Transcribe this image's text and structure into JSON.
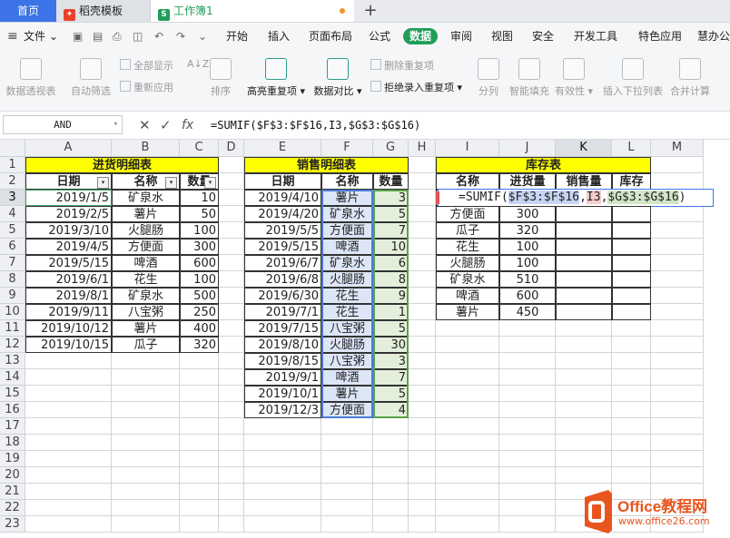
{
  "tabs": [
    {
      "label": "首页"
    },
    {
      "label": "稻壳模板"
    },
    {
      "label": "工作簿1"
    }
  ],
  "menu": {
    "file": "文件",
    "items": [
      "开始",
      "插入",
      "页面布局",
      "公式",
      "数据",
      "审阅",
      "视图",
      "安全",
      "开发工具",
      "特色应用",
      "慧办公"
    ]
  },
  "ribbon": {
    "pivot": "数据透视表",
    "autofilter": "自动筛选",
    "show_all": "全部显示",
    "reapply": "重新应用",
    "sort_az": "A↓Z",
    "sort": "排序",
    "highlight_dup": "高亮重复项",
    "data_compare": "数据对比",
    "del_dup": "删除重复项",
    "reject_dup": "拒绝录入重复项",
    "split": "分列",
    "smart_fill": "智能填充",
    "validity": "有效性",
    "insert_dropdown": "插入下拉列表",
    "merge_calc": "合并计算"
  },
  "formula_bar": {
    "name_box": "AND",
    "cancel": "✕",
    "confirm": "✓",
    "fx": "fx",
    "formula": "=SUMIF($F$3:$F$16,I3,$G$3:$G$16)"
  },
  "columns": [
    "A",
    "B",
    "C",
    "D",
    "E",
    "F",
    "G",
    "H",
    "I",
    "J",
    "K",
    "L",
    "M"
  ],
  "rows": [
    "1",
    "2",
    "3",
    "4",
    "5",
    "6",
    "7",
    "8",
    "9",
    "10",
    "11",
    "12",
    "13",
    "14",
    "15",
    "16",
    "17",
    "18",
    "19",
    "20",
    "21",
    "22",
    "23"
  ],
  "purchase": {
    "title": "进货明细表",
    "headers": [
      "日期",
      "名称",
      "数量"
    ],
    "rows": [
      [
        "2019/1/5",
        "矿泉水",
        "10"
      ],
      [
        "2019/2/5",
        "薯片",
        "50"
      ],
      [
        "2019/3/10",
        "火腿肠",
        "100"
      ],
      [
        "2019/4/5",
        "方便面",
        "300"
      ],
      [
        "2019/5/15",
        "啤酒",
        "600"
      ],
      [
        "2019/6/1",
        "花生",
        "100"
      ],
      [
        "2019/8/1",
        "矿泉水",
        "500"
      ],
      [
        "2019/9/11",
        "八宝粥",
        "250"
      ],
      [
        "2019/10/12",
        "薯片",
        "400"
      ],
      [
        "2019/10/15",
        "瓜子",
        "320"
      ]
    ]
  },
  "sales": {
    "title": "销售明细表",
    "headers": [
      "日期",
      "名称",
      "数量"
    ],
    "rows": [
      [
        "2019/4/10",
        "薯片",
        "3"
      ],
      [
        "2019/4/20",
        "矿泉水",
        "5"
      ],
      [
        "2019/5/5",
        "方便面",
        "7"
      ],
      [
        "2019/5/15",
        "啤酒",
        "10"
      ],
      [
        "2019/6/7",
        "矿泉水",
        "6"
      ],
      [
        "2019/6/8",
        "火腿肠",
        "8"
      ],
      [
        "2019/6/30",
        "花生",
        "9"
      ],
      [
        "2019/7/1",
        "花生",
        "1"
      ],
      [
        "2019/7/15",
        "八宝粥",
        "5"
      ],
      [
        "2019/8/10",
        "火腿肠",
        "30"
      ],
      [
        "2019/8/15",
        "八宝粥",
        "3"
      ],
      [
        "2019/9/1",
        "啤酒",
        "7"
      ],
      [
        "2019/10/1",
        "薯片",
        "5"
      ],
      [
        "2019/12/3",
        "方便面",
        "4"
      ]
    ]
  },
  "inventory": {
    "title": "库存表",
    "headers": [
      "名称",
      "进货量",
      "销售量",
      "库存"
    ],
    "editing": {
      "prefix": "=SUMIF(",
      "ref1": "$F$3:$F$16",
      "sep1": ",",
      "ref2": "I3",
      "sep2": ",",
      "ref3": "$G$3:$G$16",
      "suffix": ")"
    },
    "rows": [
      [
        "方便面",
        "300"
      ],
      [
        "瓜子",
        "320"
      ],
      [
        "花生",
        "100"
      ],
      [
        "火腿肠",
        "100"
      ],
      [
        "矿泉水",
        "510"
      ],
      [
        "啤酒",
        "600"
      ],
      [
        "薯片",
        "450"
      ]
    ]
  },
  "watermark": {
    "brand": "Office教程网",
    "url": "www.office26.com"
  }
}
